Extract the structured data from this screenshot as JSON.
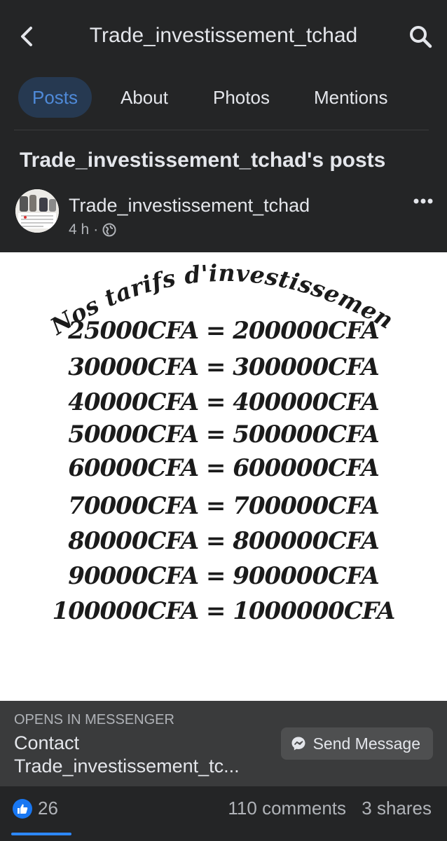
{
  "header": {
    "title": "Trade_investissement_tchad",
    "back_icon": "chevron-left-icon",
    "search_icon": "search-icon"
  },
  "tabs": [
    {
      "label": "Posts",
      "active": true
    },
    {
      "label": "About",
      "active": false
    },
    {
      "label": "Photos",
      "active": false
    },
    {
      "label": "Mentions",
      "active": false
    }
  ],
  "section_title": "Trade_investissement_tchad's posts",
  "post": {
    "author": "Trade_investissement_tchad",
    "time": "4 h",
    "separator": "·",
    "privacy_icon": "globe-icon",
    "more_icon": "more-icon",
    "image": {
      "heading": "Nos tarifs d'investissement",
      "rates": [
        "25000CFA = 200000CFA",
        "30000CFA = 300000CFA",
        "40000CFA = 400000CFA",
        "50000CFA = 500000CFA",
        "60000CFA = 600000CFA",
        "70000CFA = 700000CFA",
        "80000CFA = 800000CFA",
        "90000CFA = 900000CFA",
        "100000CFA = 1000000CFA"
      ]
    },
    "cta": {
      "kicker": "OPENS IN MESSENGER",
      "title": "Contact Trade_investissement_tc...",
      "button_label": "Send Message"
    },
    "stats": {
      "likes": "26",
      "comments": "110 comments",
      "shares": "3 shares"
    }
  },
  "colors": {
    "background": "#242526",
    "accent": "#1877f2",
    "tab_active_bg": "#263951",
    "tab_active_text": "#4f8ad9"
  }
}
